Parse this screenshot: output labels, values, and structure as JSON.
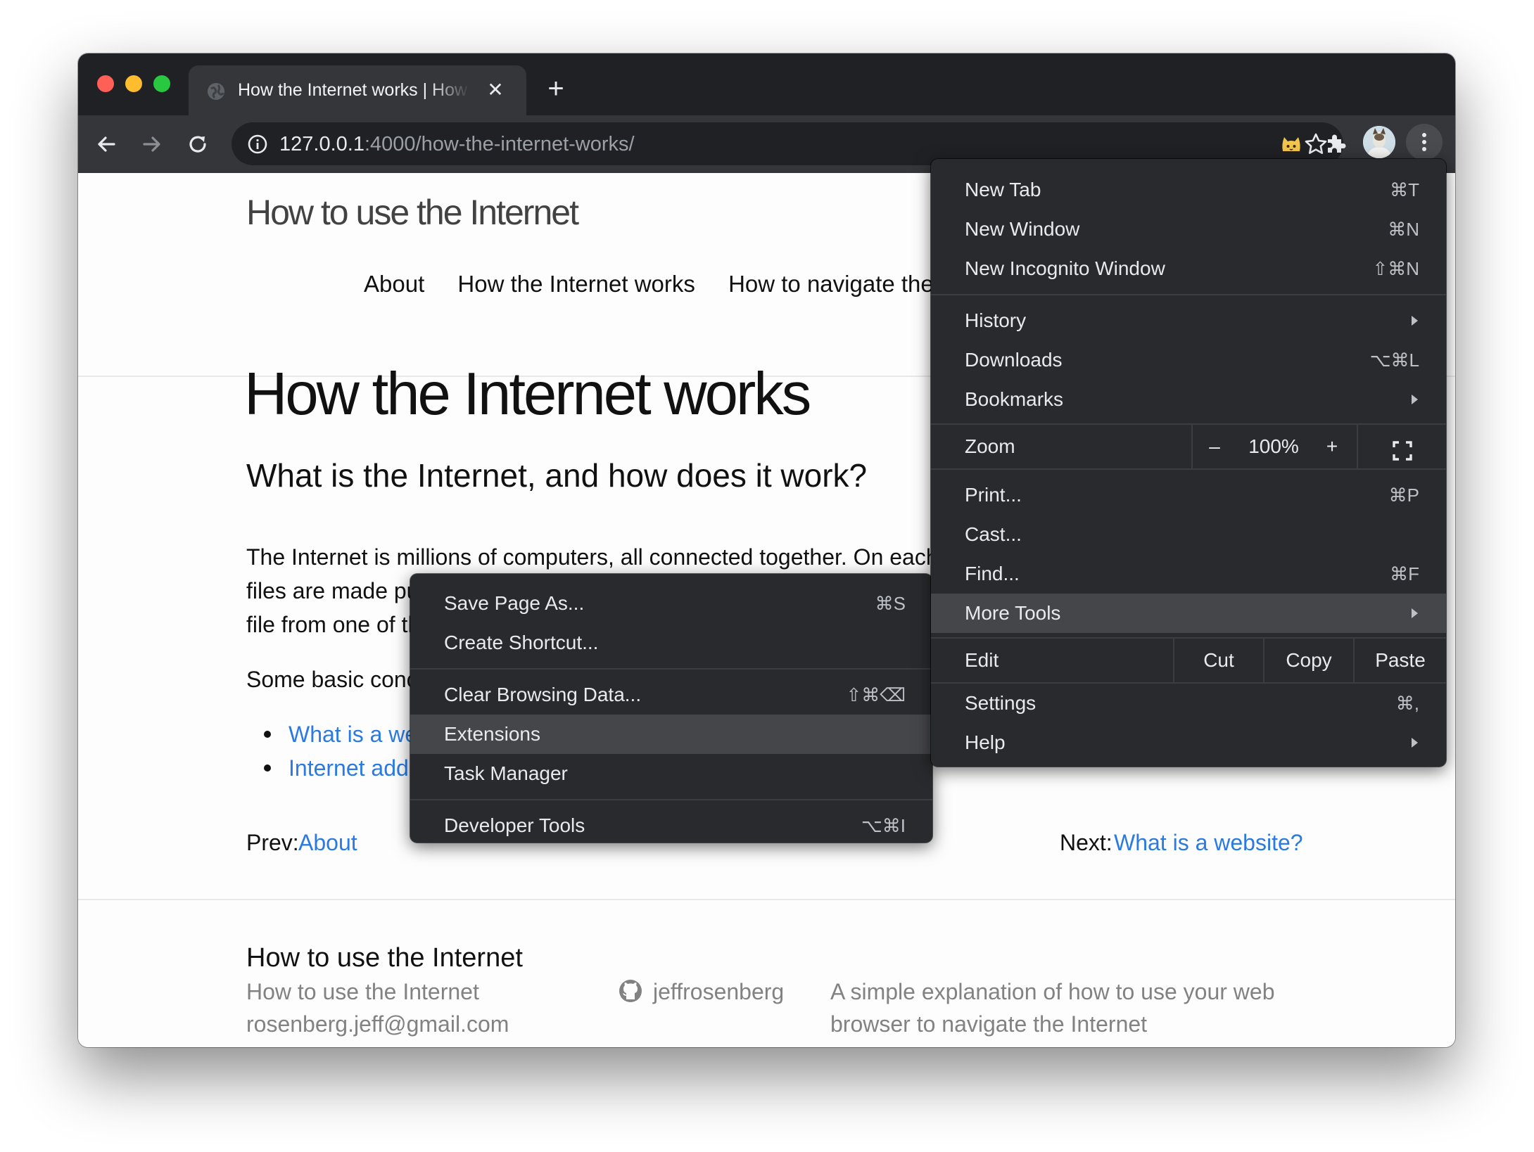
{
  "browser": {
    "tab_title": "How the Internet works | How to use the Internet",
    "tab_close": "✕",
    "new_tab_symbol": "+",
    "url_host": "127.0.0.1",
    "url_rest": ":4000/how-the-internet-works/"
  },
  "site": {
    "title": "How to use the Internet",
    "nav": [
      "About",
      "How the Internet works",
      "How to navigate the Internet"
    ]
  },
  "article": {
    "h1": "How the Internet works",
    "h2": "What is the Internet, and how does it work?",
    "p1_line1": "The Internet is millions of computers, all connected together. On each computer,",
    "p1_line2": "files are made public",
    "p1_line3": "file from one of them",
    "p2": "Some basic concepts:",
    "list": [
      "What is a website?",
      "Internet addresses"
    ],
    "prev_label": "Prev:",
    "prev_link": "About",
    "next_label": "Next:",
    "next_link": "What is a website?"
  },
  "footer": {
    "heading": "How to use the Internet",
    "col1_line1": "How to use the Internet",
    "col1_line2": "rosenberg.jeff@gmail.com",
    "github_user": "jeffrosenberg",
    "description_line1": "A simple explanation of how to use your web",
    "description_line2": "browser to navigate the Internet"
  },
  "chrome_menu": {
    "new_tab": "New Tab",
    "new_tab_sc": "⌘T",
    "new_window": "New Window",
    "new_window_sc": "⌘N",
    "incognito": "New Incognito Window",
    "incognito_sc": "⇧⌘N",
    "history": "History",
    "downloads": "Downloads",
    "downloads_sc": "⌥⌘L",
    "bookmarks": "Bookmarks",
    "zoom": "Zoom",
    "zoom_minus": "–",
    "zoom_value": "100%",
    "zoom_plus": "+",
    "print": "Print...",
    "print_sc": "⌘P",
    "cast": "Cast...",
    "find": "Find...",
    "find_sc": "⌘F",
    "more_tools": "More Tools",
    "edit": "Edit",
    "cut": "Cut",
    "copy": "Copy",
    "paste": "Paste",
    "settings": "Settings",
    "settings_sc": "⌘,",
    "help": "Help"
  },
  "more_tools_menu": {
    "save_page": "Save Page As...",
    "save_page_sc": "⌘S",
    "create_shortcut": "Create Shortcut...",
    "clear_data": "Clear Browsing Data...",
    "clear_data_sc": "⇧⌘⌫",
    "extensions": "Extensions",
    "task_manager": "Task Manager",
    "dev_tools": "Developer Tools",
    "dev_tools_sc": "⌥⌘I"
  },
  "colors": {
    "link": "#2a7ae2",
    "menu_bg": "#292a2d",
    "menu_highlight": "#45464a",
    "titlebar": "#202124",
    "toolbar": "#35363a"
  }
}
